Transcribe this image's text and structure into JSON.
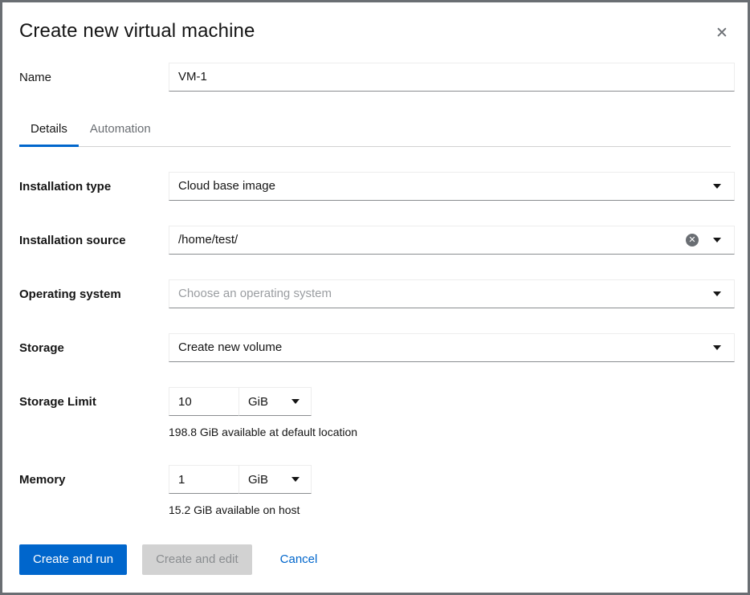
{
  "dialog": {
    "title": "Create new virtual machine",
    "close_icon": "close-icon"
  },
  "name_field": {
    "label": "Name",
    "value": "VM-1",
    "placeholder": ""
  },
  "tabs": [
    {
      "label": "Details",
      "active": true
    },
    {
      "label": "Automation",
      "active": false
    }
  ],
  "fields": {
    "installation_type": {
      "label": "Installation type",
      "value": "Cloud base image",
      "caret_icon": "chevron-down-icon"
    },
    "installation_source": {
      "label": "Installation source",
      "value": "/home/test/",
      "clear_icon": "clear-circle-icon",
      "caret_icon": "chevron-down-icon"
    },
    "operating_system": {
      "label": "Operating system",
      "value": "",
      "placeholder": "Choose an operating system",
      "caret_icon": "chevron-down-icon"
    },
    "storage": {
      "label": "Storage",
      "value": "Create new volume",
      "caret_icon": "chevron-down-icon"
    },
    "storage_limit": {
      "label": "Storage Limit",
      "value": "10",
      "unit": "GiB",
      "helper": "198.8 GiB available at default location",
      "caret_icon": "chevron-down-icon"
    },
    "memory": {
      "label": "Memory",
      "value": "1",
      "unit": "GiB",
      "helper": "15.2 GiB available on host",
      "caret_icon": "chevron-down-icon"
    }
  },
  "footer": {
    "primary_label": "Create and run",
    "secondary_label": "Create and edit",
    "cancel_label": "Cancel"
  },
  "colors": {
    "accent": "#0066cc",
    "text": "#151515",
    "muted": "#6a6e73",
    "disabled_bg": "#d2d2d2"
  }
}
